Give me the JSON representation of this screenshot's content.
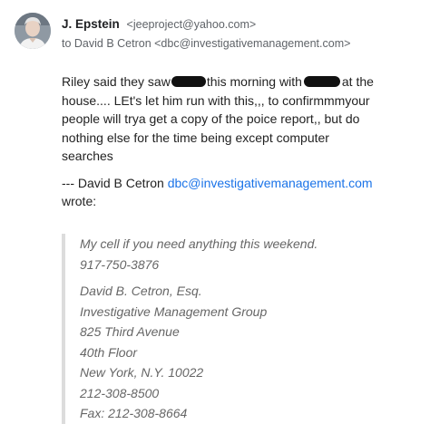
{
  "sender": {
    "name": "J. Epstein",
    "email": "<jeeproject@yahoo.com>"
  },
  "recipient_line": "to David B Cetron <dbc@investigativemanagement.com>",
  "message": {
    "part1": "Riley said they saw",
    "part2": "this morning with",
    "part3": "at the house.... LEt's let him run with this,,, to confirmmmyour people will trya get a copy of the poice report,, but do nothing else for the time being except computer searches"
  },
  "quote_header": {
    "prefix": "--- David B Cetron ",
    "link": "dbc@investigativemanagement.com",
    "suffix": " wrote:"
  },
  "quoted": {
    "intro": "My cell if you need anything this weekend.",
    "cell": "917-750-3876",
    "signature": [
      "David B. Cetron, Esq.",
      "Investigative Management Group",
      "825 Third Avenue",
      "40th Floor",
      "New York, N.Y. 10022",
      "212-308-8500",
      "Fax: 212-308-8664"
    ]
  },
  "colors": {
    "link": "#1a73e8",
    "quote_bar": "#dcdcdc",
    "redaction": "#111111"
  }
}
